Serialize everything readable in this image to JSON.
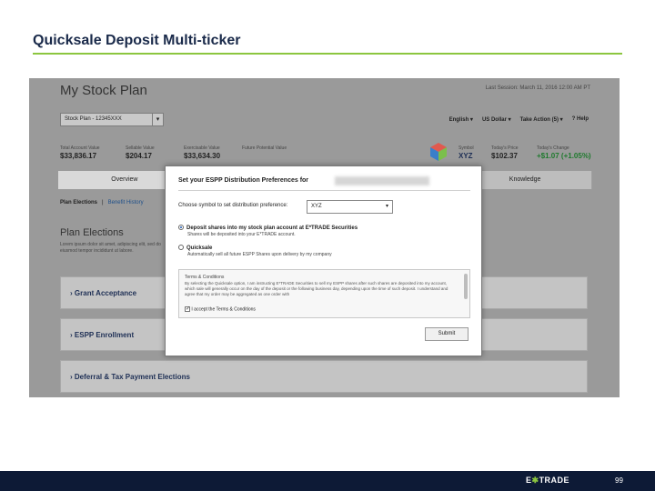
{
  "slide": {
    "title": "Quicksale Deposit Multi-ticker",
    "page_number": "99",
    "footer_logo_left": "E",
    "footer_logo_star": "✱",
    "footer_logo_right": "TRADE",
    "colors": {
      "accent_rule": "#8cc63f",
      "footer_bg": "#0d1a36"
    }
  },
  "app": {
    "title": "My Stock Plan",
    "last_login": "Last Session: March 11, 2016 12:00 AM PT",
    "plan_select": {
      "value": "Stock Plan - 12345XXX"
    },
    "toolbar": {
      "language": "English ▾",
      "currency": "US Dollar ▾",
      "take_action": "Take Action (5) ▾",
      "help": "? Help"
    },
    "metrics": [
      {
        "label": "Total Account Value",
        "value": "$33,836.17"
      },
      {
        "label": "Sellable Value",
        "value": "$204.17"
      },
      {
        "label": "Exercisable Value",
        "value": "$33,634.30"
      },
      {
        "label": "Future Potential Value",
        "value": ""
      },
      {
        "label": "Symbol",
        "value": "XYZ"
      },
      {
        "label": "Today's Price",
        "value": "$102.37"
      },
      {
        "label": "Today's Change",
        "value": "+$1.07 (+1.05%)"
      }
    ],
    "tabs": [
      "Overview",
      "",
      "",
      "Knowledge"
    ],
    "subtabs": {
      "active": "Plan Elections",
      "separator": "|",
      "other": "Benefit History"
    },
    "section": {
      "title": "Plan Elections",
      "description": "Lorem ipsum dolor sit amet, adipiscing elit, sed do eiusmod tempor incididunt ut labore."
    },
    "accordions": [
      {
        "label": "Grant Acceptance"
      },
      {
        "label": "ESPP Enrollment"
      },
      {
        "label": "Deferral & Tax Payment Elections"
      }
    ]
  },
  "modal": {
    "title": "Set your ESPP Distribution Preferences for",
    "symbol_label": "Choose symbol to set distribution preference:",
    "symbol_value": "XYZ",
    "option1": {
      "label": "Deposit shares into my stock plan account at E*TRADE Securities",
      "sub": "Shares will be deposited into your E*TRADE account."
    },
    "option2": {
      "label": "Quicksale",
      "sub": "Automatically sell all future ESPP Shares upon delivery by my company"
    },
    "terms": {
      "title": "Terms & Conditions",
      "text": "By selecting the Quicksale option, I am instructing E*TRADE Securities to sell my ESPP shares after such shares are deposited into my account, which sale will generally occur on the day of the deposit or the following business day, depending upon the time of such deposit. I understand and agree that my order may be aggregated as one order with",
      "agree": "I accept the Terms & Conditions",
      "checkmark": "✓"
    },
    "submit_label": "Submit"
  }
}
